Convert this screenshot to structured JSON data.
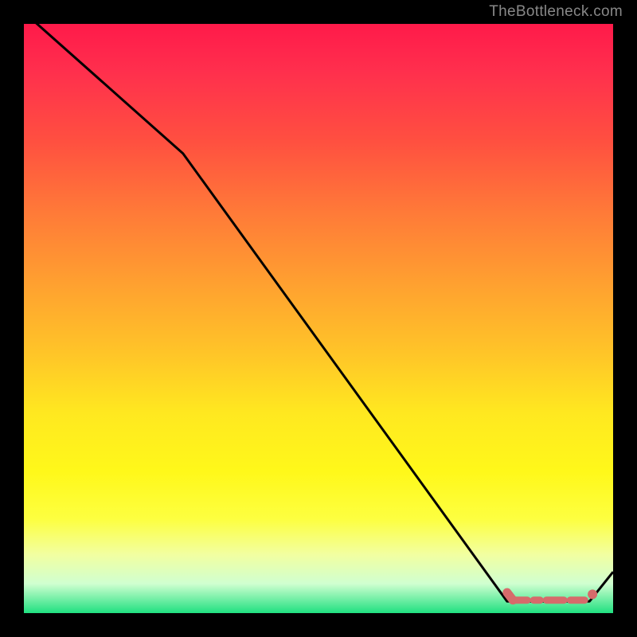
{
  "watermark": "TheBottleneck.com",
  "chart_data": {
    "type": "line",
    "title": "",
    "xlabel": "",
    "ylabel": "",
    "xlim": [
      0,
      100
    ],
    "ylim": [
      0,
      100
    ],
    "series": [
      {
        "name": "bottleneck-curve",
        "color": "#000000",
        "x": [
          0,
          27,
          82,
          96,
          100
        ],
        "y": [
          102,
          78,
          2,
          2,
          7
        ]
      },
      {
        "name": "optimal-zone-marker",
        "color": "#d66b6b",
        "x": [
          82,
          83,
          96,
          96.5
        ],
        "y": [
          3.5,
          2.2,
          2.2,
          3.2
        ]
      }
    ],
    "annotations": []
  }
}
